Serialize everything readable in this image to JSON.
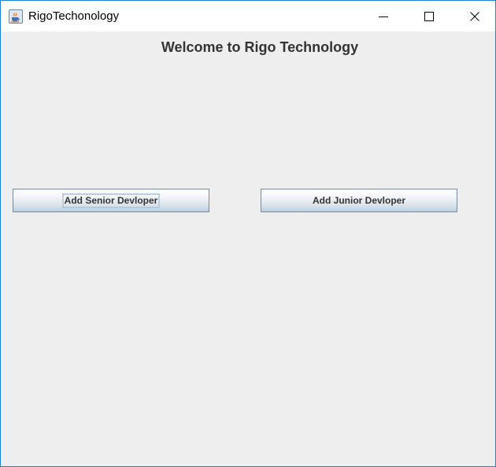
{
  "window": {
    "title": "RigoTechonology",
    "app_icon": "java-coffee-icon",
    "controls": {
      "minimize_icon": "minimize-icon",
      "maximize_icon": "maximize-icon",
      "close_icon": "close-icon"
    },
    "border_color": "#1883d7"
  },
  "main": {
    "heading": "Welcome to Rigo Technology",
    "buttons": {
      "senior_label": "Add Senior Devloper",
      "junior_label": "Add Junior Devloper"
    }
  },
  "colors": {
    "background": "#eeeeee",
    "button_border": "#7a8a99",
    "text": "#333333"
  }
}
